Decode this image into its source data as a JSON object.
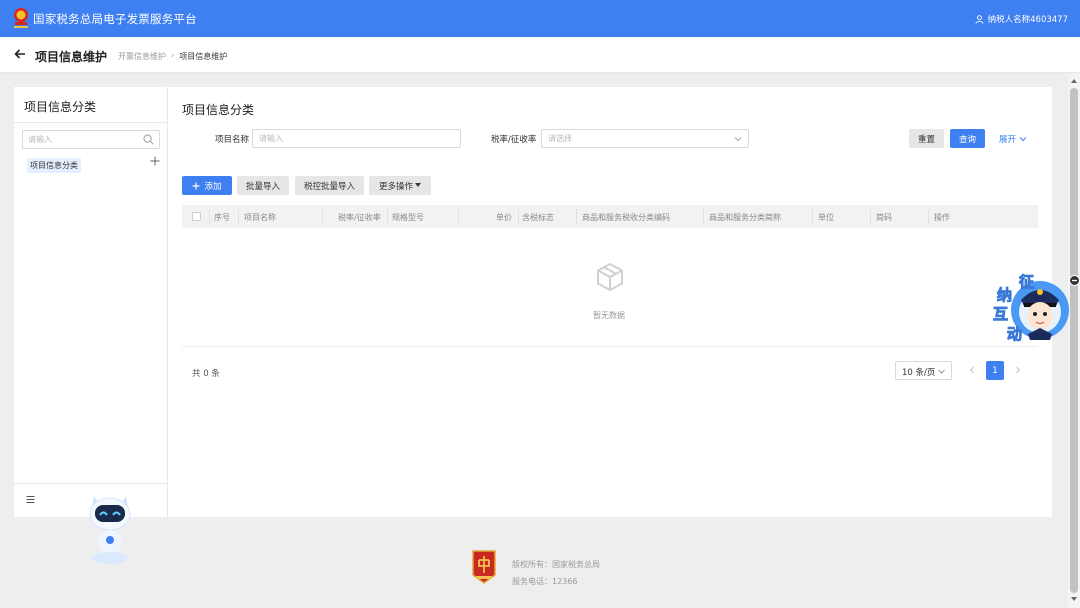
{
  "app": {
    "title": "国家税务总局电子发票服务平台",
    "user": "纳税人名称4603477",
    "accent": "#3e7ff1"
  },
  "header": {
    "title": "项目信息维护",
    "breadcrumb": [
      "开票信息维护",
      "项目信息维护"
    ]
  },
  "sidebar": {
    "title": "项目信息分类",
    "search_placeholder": "请输入",
    "tree": [
      {
        "label": "项目信息分类"
      }
    ]
  },
  "main": {
    "title": "项目信息分类",
    "filters": {
      "name_label": "项目名称",
      "name_placeholder": "请输入",
      "rate_label": "税率/征收率",
      "rate_placeholder": "请选择"
    },
    "buttons": {
      "reset": "重置",
      "query": "查询",
      "expand": "展开",
      "add": "添加",
      "batch_import": "批量导入",
      "tax_batch_import": "税控批量导入",
      "more": "更多操作"
    },
    "table": {
      "columns": [
        "序号",
        "项目名称",
        "税率/征收率",
        "规格型号",
        "单价",
        "含税标志",
        "商品和服务税收分类编码",
        "商品和服务分类简称",
        "单位",
        "简码",
        "操作"
      ],
      "empty_text": "暂无数据"
    },
    "pagination": {
      "total": "共 0 条",
      "page_size": "10 条/页",
      "current_page": "1"
    }
  },
  "footer": {
    "copyright": "版权所有：国家税务总局",
    "phone": "服务电话：12366"
  },
  "badge": {
    "chars": [
      "征",
      "纳",
      "互",
      "动"
    ]
  }
}
